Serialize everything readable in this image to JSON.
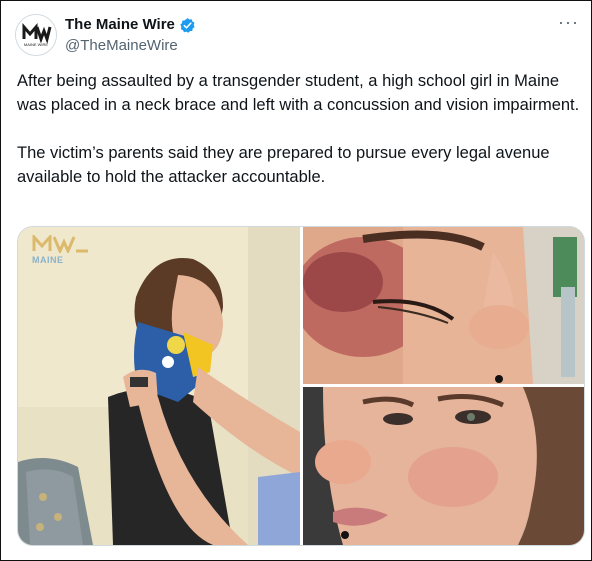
{
  "post": {
    "author_name": "The Maine Wire",
    "author_handle": "@TheMaineWire",
    "avatar_text": "MAINE WIRE",
    "more_label": "···",
    "paragraphs": [
      "After being assaulted by a transgender student, a high school girl in Maine was placed in a neck brace and left with a concussion and vision impairment.",
      "The victim’s parents said they are prepared to pursue every legal avenue available to hold the attacker accountable."
    ]
  },
  "media": {
    "watermark_text": "MAINE"
  },
  "colors": {
    "verified": "#1d9bf0",
    "text": "#0f1419",
    "secondary": "#536471"
  },
  "icons": {
    "verified": "verified-badge-icon",
    "more": "more-options-icon"
  }
}
